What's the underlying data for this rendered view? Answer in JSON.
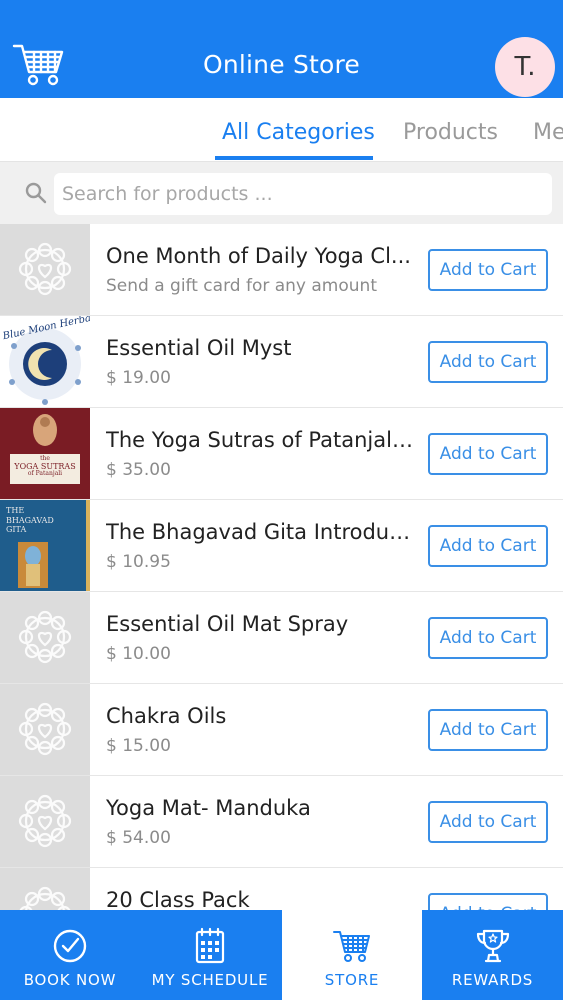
{
  "header": {
    "title": "Online Store",
    "avatar_initial": "T.",
    "cart_icon": "cart-icon"
  },
  "tabs": [
    {
      "label": "All Categories",
      "active": true
    },
    {
      "label": "Products",
      "active": false
    },
    {
      "label": "Me",
      "active": false
    }
  ],
  "search": {
    "placeholder": "Search for products ...",
    "value": ""
  },
  "products": [
    {
      "name": "One Month of Daily Yoga Cl...",
      "subtitle": "Send a gift card for any amount",
      "button": "Add to Cart",
      "thumb": "placeholder"
    },
    {
      "name": "Essential Oil Myst",
      "subtitle": "$ 19.00",
      "button": "Add to Cart",
      "thumb": "blue-moon-herbals"
    },
    {
      "name": "The Yoga Sutras of Patanjali ...",
      "subtitle": "$ 35.00",
      "button": "Add to Cart",
      "thumb": "yoga-sutras-book"
    },
    {
      "name": "The Bhagavad Gita Introduc...",
      "subtitle": "$ 10.95",
      "button": "Add to Cart",
      "thumb": "bhagavad-gita-book"
    },
    {
      "name": "Essential Oil Mat Spray",
      "subtitle": "$ 10.00",
      "button": "Add to Cart",
      "thumb": "placeholder"
    },
    {
      "name": "Chakra Oils",
      "subtitle": "$ 15.00",
      "button": "Add to Cart",
      "thumb": "placeholder"
    },
    {
      "name": "Yoga Mat- Manduka",
      "subtitle": "$ 54.00",
      "button": "Add to Cart",
      "thumb": "placeholder"
    },
    {
      "name": "20 Class Pack",
      "subtitle": "",
      "button": "Add to Cart",
      "thumb": "placeholder"
    }
  ],
  "book_covers": {
    "blue_moon": "Blue Moon Herbals",
    "sutras_line1": "the",
    "sutras_line2": "YOGA SUTRAS",
    "sutras_line3": "of Patanjali",
    "gita_line1": "THE",
    "gita_line2": "BHAGAVAD",
    "gita_line3": "GITA"
  },
  "bottom_nav": [
    {
      "label": "BOOK NOW",
      "icon": "check-circle-icon",
      "active": false
    },
    {
      "label": "MY SCHEDULE",
      "icon": "calendar-icon",
      "active": false
    },
    {
      "label": "STORE",
      "icon": "cart-icon",
      "active": true
    },
    {
      "label": "REWARDS",
      "icon": "trophy-icon",
      "active": false
    }
  ],
  "colors": {
    "brand_blue": "#1a7ff0",
    "button_blue": "#3a8fe6",
    "avatar_pink": "#fde0e6"
  }
}
